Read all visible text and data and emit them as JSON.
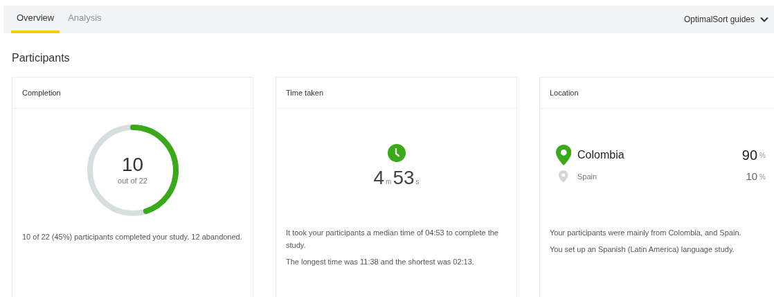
{
  "tabs": [
    {
      "label": "Overview",
      "selected": true
    },
    {
      "label": "Analysis",
      "selected": false
    }
  ],
  "guides_menu": {
    "label": "OptimalSort guides"
  },
  "section_title": "Participants",
  "completion": {
    "title": "Completion",
    "count": "10",
    "count_caption": "out of 22",
    "level": 0.45,
    "description": "10 of 22 (45%) participants completed your study. 12 abandoned."
  },
  "time_taken": {
    "title": "Time taken",
    "minutes": "4",
    "minutes_unit": "m",
    "seconds": "53",
    "seconds_unit": "s",
    "paragraphs": [
      "It took your participants a median time of 04:53 to complete the study.",
      "The longest time was 11:38 and the shortest was 02:13."
    ]
  },
  "location": {
    "title": "Location",
    "countries": [
      {
        "name": "Colombia",
        "percent": "90",
        "unit": "%",
        "kind": "primary"
      },
      {
        "name": "Spain",
        "percent": "10",
        "unit": "%",
        "kind": "secondary"
      }
    ],
    "paragraphs": [
      "Your participants were mainly from Colombia, and Spain.",
      "You set up an Spanish (Latin America) language study."
    ]
  }
}
